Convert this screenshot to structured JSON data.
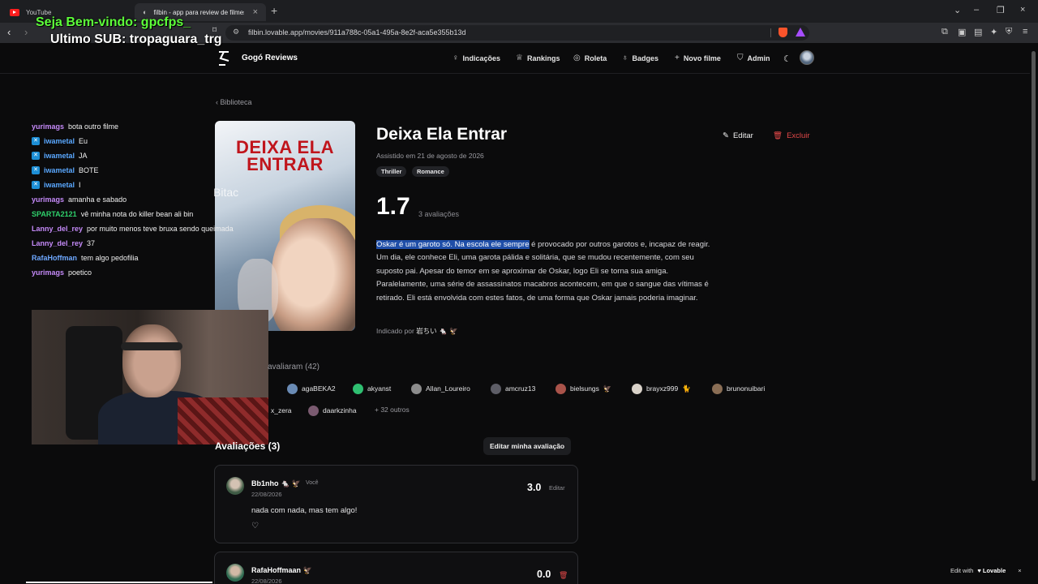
{
  "browser": {
    "tabs": [
      {
        "label": "YouTube"
      },
      {
        "label": "filbin - app para review de filmes",
        "close": "×"
      }
    ],
    "new_tab": "+",
    "url": "filbin.lovable.app/movies/911a788c-05a1-495a-8e2f-aca5e355b13d",
    "window_controls": [
      "⌄",
      "–",
      "❐",
      "×"
    ]
  },
  "stream_overlay": {
    "welcome": "Seja Bem-vindo: gpcfps_",
    "last_sub": "Ultimo SUB: tropaguara_trg"
  },
  "site": {
    "brand": "Gogó Reviews",
    "nav": [
      {
        "label": "Indicações",
        "icon": "lightbulb-icon"
      },
      {
        "label": "Rankings",
        "icon": "trophy-icon"
      },
      {
        "label": "Roleta",
        "icon": "roulette-icon"
      },
      {
        "label": "Badges",
        "icon": "medal-icon"
      },
      {
        "label": "Novo filme",
        "icon": "plus-icon"
      },
      {
        "label": "Admin",
        "icon": "shield-icon"
      }
    ]
  },
  "breadcrumb": {
    "label": "Biblioteca"
  },
  "chat": [
    {
      "user": "yurimags",
      "color": "#c58af9",
      "badge": false,
      "msg": "bota outro filme"
    },
    {
      "user": "iwametal",
      "color": "#5aa8ff",
      "badge": true,
      "msg": "Eu"
    },
    {
      "user": "iwametal",
      "color": "#5aa8ff",
      "badge": true,
      "msg": "JA"
    },
    {
      "user": "iwametal",
      "color": "#5aa8ff",
      "badge": true,
      "msg": "BOTE"
    },
    {
      "user": "iwametal",
      "color": "#5aa8ff",
      "badge": true,
      "msg": "I"
    },
    {
      "user": "yurimags",
      "color": "#c58af9",
      "badge": false,
      "msg": "amanha e sabado"
    },
    {
      "user": "SPARTA2121",
      "color": "#2fd06b",
      "badge": false,
      "msg": "vê minha nota do killer bean ali bin"
    },
    {
      "user": "Lanny_del_rey",
      "color": "#c58af9",
      "badge": false,
      "msg": "por muito menos teve bruxa sendo queimada"
    },
    {
      "user": "Lanny_del_rey",
      "color": "#c58af9",
      "badge": false,
      "msg": "37"
    },
    {
      "user": "RafaHoffman",
      "color": "#6ea8ff",
      "badge": false,
      "msg": "tem algo pedofilia"
    },
    {
      "user": "yurimags",
      "color": "#c58af9",
      "badge": false,
      "msg": "poetico"
    }
  ],
  "poster": {
    "title": "DEIXA ELA ENTRAR",
    "overlay_text": "Bitac"
  },
  "movie": {
    "title": "Deixa Ela Entrar",
    "watched": "Assistido em 21 de agosto de 2026",
    "genres": [
      "Thriller",
      "Romance"
    ],
    "edit_label": "Editar",
    "delete_label": "Excluir",
    "score": "1.7",
    "rating_count": "3 avaliações",
    "synopsis_highlight": "Oskar é um garoto só. Na escola ele sempre",
    "synopsis_rest": " é provocado por outros garotos e, incapaz de reagir. Um dia, ele conhece Eli, uma garota pálida e solitária, que se mudou recentemente, com seu suposto pai. Apesar do temor em se aproximar de Oskar, logo Eli se torna sua amiga. Paralelamente, uma série de assassinatos macabros acontecem, em que o sangue das vítimas é retirado. Eli está envolvida com estes fatos, de uma forma que Oskar jamais poderia imaginar.",
    "indicated_prefix": "Indicado por",
    "indicated_by": "岩ちい 🐁 🦅"
  },
  "raters": {
    "heading": "avaliaram (42)",
    "chips": [
      {
        "name": "agaBEKA2",
        "suffix": ""
      },
      {
        "name": "akyanst",
        "suffix": ""
      },
      {
        "name": "Allan_Loureiro",
        "suffix": ""
      },
      {
        "name": "amcruz13",
        "suffix": ""
      },
      {
        "name": "bielsungs",
        "suffix": "🦅"
      },
      {
        "name": "brayxz999",
        "suffix": "🐈"
      },
      {
        "name": "brunonuibari",
        "suffix": ""
      },
      {
        "name": "x_zera",
        "suffix": ""
      },
      {
        "name": "daarkzinha",
        "suffix": ""
      }
    ],
    "more": "+ 32 outros"
  },
  "reviews": {
    "heading": "Avaliações (3)",
    "edit_mine": "Editar minha avaliação",
    "items": [
      {
        "user": "Bb1nho 🐁 🦅",
        "you": "Você",
        "date": "22/08/2026",
        "score": "3.0",
        "edit": "Editar",
        "text": "nada com nada, mas tem algo!",
        "heart": "♡"
      },
      {
        "user": "RafaHoffmaan 🦅",
        "date": "22/08/2026",
        "score": "0.0",
        "trash": "🗑"
      }
    ]
  },
  "lovable": {
    "prefix": "Edit with",
    "brand": "♥ Lovable",
    "close": "×"
  }
}
